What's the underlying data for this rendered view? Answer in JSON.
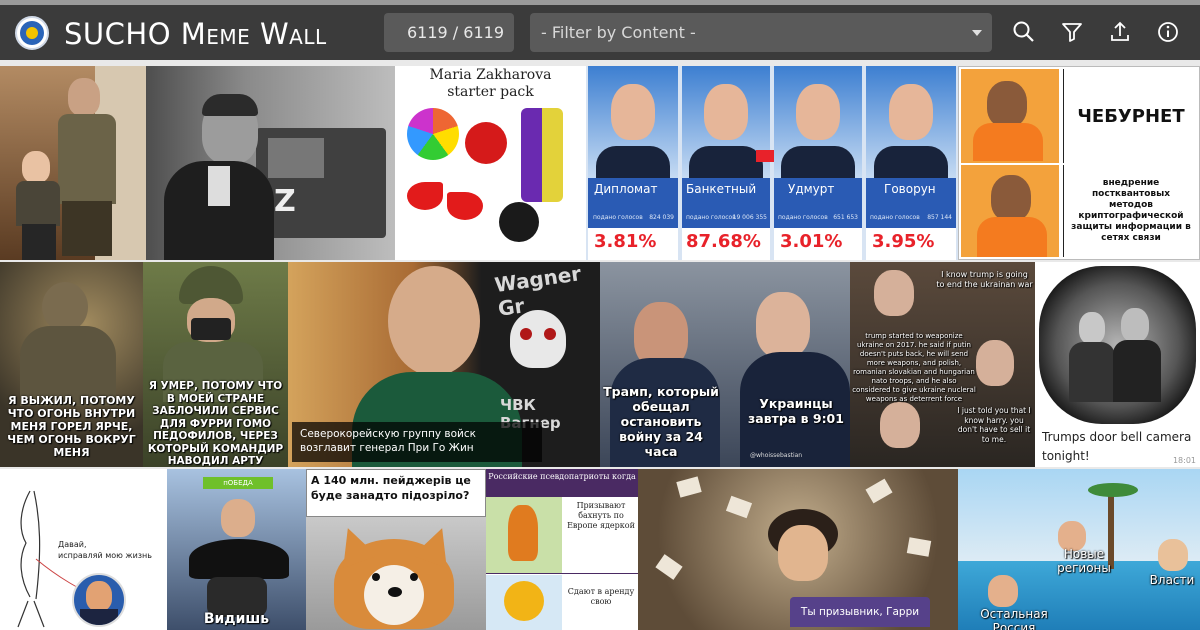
{
  "header": {
    "title": "SUCHO Meme Wall",
    "counter": "6119 / 6119",
    "filter_placeholder": "- Filter by Content -",
    "colors": {
      "bar": "#3b3b3b",
      "control": "#5a5a5a",
      "text": "#ffffff"
    },
    "icons": [
      "logo-icon",
      "search-icon",
      "filter-icon",
      "upload-icon",
      "info-icon"
    ]
  },
  "memes": {
    "zakharova": {
      "line1": "Maria Zakharova",
      "line2": "starter pack"
    },
    "putin_poll": {
      "candidates": [
        "Дипломат",
        "Банкетный",
        "Удмурт",
        "Говорун"
      ],
      "percents": [
        "3.81%",
        "87.68%",
        "3.01%",
        "3.95%"
      ],
      "sub_label": "подано голосов",
      "counts": [
        "824 039",
        "19 006 355",
        "651 653",
        "857 144"
      ]
    },
    "drake": {
      "top_text": "ЧЕБУРНЕТ",
      "bottom_text": "внедрение постквантовых методов криптографической защиты информации в сетях связи"
    },
    "soldier1": {
      "caption": "Я ВЫЖИЛ, ПОТОМУ ЧТО ОГОНЬ ВНУТРИ МЕНЯ ГОРЕЛ ЯРЧЕ, ЧЕМ ОГОНЬ ВОКРУГ МЕНЯ"
    },
    "soldier2": {
      "caption": "Я УМЕР, ПОТОМУ ЧТО В МОЕЙ СТРАНЕ ЗАБЛОЧИЛИ СЕРВИС ДЛЯ ФУРРИ ГОМО ПЕДОФИЛОВ, ЧЕРЕЗ КОТОРЫЙ КОМАНДИР НАВОДИЛ АРТУ"
    },
    "wagner": {
      "logo_text_top": "Wagner Gr",
      "logo_text_bottom": "ЧВК Вагнер",
      "caption": "Северокорейскую группу войск возглавит генерал При Го Жин"
    },
    "trump_promise": {
      "left": "Трамп, который обещал остановить войну за 24 часа",
      "right": "Украинцы завтра в 9:01",
      "watermark": "@whoissebastian"
    },
    "trump_chat": {
      "top": "I know trump is going to end the ukrainan war",
      "middle": "trump started to weaponize ukraine on 2017. he said if putin doesn't puts back, he will send more weapons, and polish, romanian slovakian and hungarian nato troops, and he also considered to give ukraine nucleral weapons as deterrent force",
      "bottom": "I just told you that I know harry. you don't have to sell it to me."
    },
    "doorbell": {
      "caption": "Trumps door bell camera tonight!",
      "time": "18:01"
    },
    "sketch": {
      "line1": "Давай,",
      "line2": "исправляй мою жизнь"
    },
    "vidish": {
      "sign": "пОБЕДА",
      "caption": "Видишь"
    },
    "corgi": {
      "question": "А 140 млн. пейджерів це буде занадто підозріло?"
    },
    "pseudo": {
      "header": "Российские псевдопатриоты когда",
      "row1": "Призывают бахнуть по Европе ядеркой",
      "row2": "Сдают в аренду свою"
    },
    "harry": {
      "caption": "Ты призывник, Гарри"
    },
    "pool": {
      "label1": "Новые регионы",
      "label2": "Власти",
      "label3": "Остальная Россия"
    }
  }
}
